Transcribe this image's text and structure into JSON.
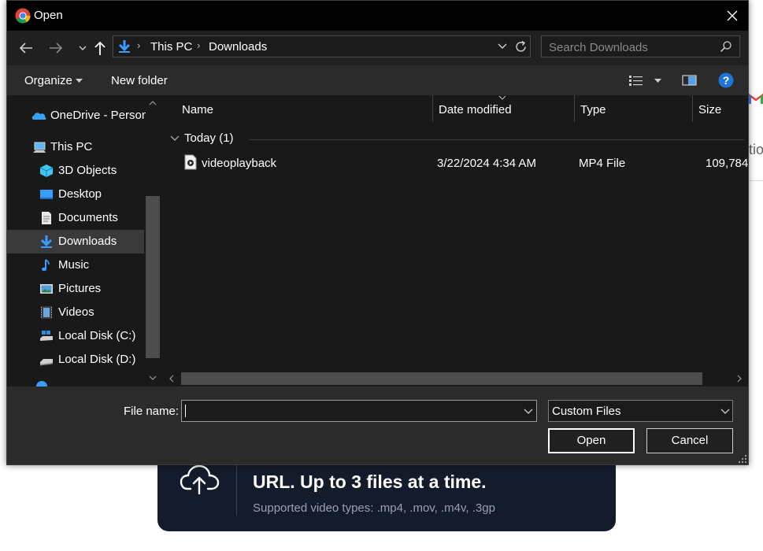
{
  "dialog": {
    "title": "Open",
    "breadcrumb": [
      "This PC",
      "Downloads"
    ],
    "search_placeholder": "Search Downloads",
    "toolbar": {
      "organize": "Organize",
      "new_folder": "New folder"
    },
    "nav_items": [
      {
        "label": "OneDrive - Person",
        "icon": "onedrive-icon"
      },
      {
        "label": "This PC",
        "icon": "pc-icon"
      },
      {
        "label": "3D Objects",
        "icon": "3d-objects-icon"
      },
      {
        "label": "Desktop",
        "icon": "desktop-icon"
      },
      {
        "label": "Documents",
        "icon": "documents-icon"
      },
      {
        "label": "Downloads",
        "icon": "downloads-icon",
        "selected": true
      },
      {
        "label": "Music",
        "icon": "music-icon"
      },
      {
        "label": "Pictures",
        "icon": "pictures-icon"
      },
      {
        "label": "Videos",
        "icon": "videos-icon"
      },
      {
        "label": "Local Disk (C:)",
        "icon": "disk-icon"
      },
      {
        "label": "Local Disk (D:)",
        "icon": "disk-icon"
      }
    ],
    "columns": {
      "name": "Name",
      "date": "Date modified",
      "type": "Type",
      "size": "Size"
    },
    "group_label": "Today (1)",
    "files": [
      {
        "name": "videoplayback",
        "date": "3/22/2024 4:34 AM",
        "type": "MP4 File",
        "size": "109,784"
      }
    ],
    "file_name_label": "File name:",
    "file_name_value": "",
    "file_type": "Custom Files",
    "open_button": "Open",
    "cancel_button": "Cancel"
  },
  "background": {
    "upload_title": "URL. Up to 3 files at a time.",
    "upload_sub": "Supported video types: .mp4, .mov, .m4v, .3gp",
    "partial_text": "tio"
  }
}
